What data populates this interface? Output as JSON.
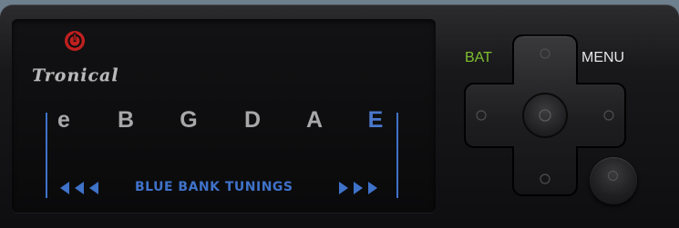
{
  "brand": {
    "name": "Tronical",
    "icon": "power-icon",
    "icon_color": "#c0201f"
  },
  "strings": [
    {
      "label": "e",
      "active": false
    },
    {
      "label": "B",
      "active": false
    },
    {
      "label": "G",
      "active": false
    },
    {
      "label": "D",
      "active": false
    },
    {
      "label": "A",
      "active": false
    },
    {
      "label": "E",
      "active": true
    }
  ],
  "bank": {
    "label": "BLUE BANK TUNINGS",
    "prev_icon": "triple-left-arrow-icon",
    "next_icon": "triple-right-arrow-icon"
  },
  "controls": {
    "bat_label": "BAT",
    "menu_label": "MENU",
    "dpad_icon": "dpad-icon",
    "extra_button_icon": "round-button-icon"
  },
  "colors": {
    "accent_blue": "#3f72c9",
    "bat_green": "#7fbf2f",
    "string_text": "#a8a8aa",
    "logo_red": "#c0201f"
  }
}
